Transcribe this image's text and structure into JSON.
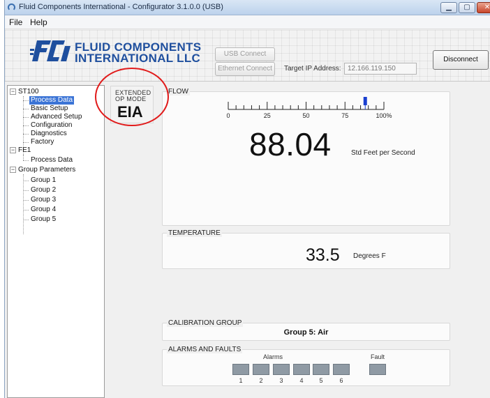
{
  "window": {
    "title": "Fluid Components International - Configurator 3.1.0.0 (USB)"
  },
  "menu": {
    "file": "File",
    "help": "Help"
  },
  "header": {
    "logo_line1": "FLUID COMPONENTS",
    "logo_line2": "INTERNATIONAL LLC",
    "logo_mark": "FCI",
    "usb_connect": "USB Connect",
    "ethernet_connect": "Ethernet Connect",
    "target_ip_label": "Target IP Address:",
    "target_ip_value": "12.166.119.150",
    "disconnect": "Disconnect"
  },
  "tree": {
    "st100": "ST100",
    "st100_children": [
      "Process Data",
      "Basic Setup",
      "Advanced Setup",
      "Configuration",
      "Diagnostics",
      "Factory"
    ],
    "fe1": "FE1",
    "fe1_children": [
      "Process Data"
    ],
    "group_params": "Group Parameters",
    "group_children": [
      "Group 1",
      "Group 2",
      "Group 3",
      "Group 4",
      "Group 5"
    ]
  },
  "op_mode": {
    "label_line1": "EXTENDED",
    "label_line2": "OP MODE",
    "value": "EIA"
  },
  "flow": {
    "title": "FLOW",
    "value": "88.04",
    "unit": "Std Feet per Second",
    "scale_labels": [
      "0",
      "25",
      "50",
      "75",
      "100%"
    ],
    "indicator_percent": 88
  },
  "temperature": {
    "title": "TEMPERATURE",
    "value": "33.5",
    "unit": "Degrees F"
  },
  "calibration": {
    "title": "CALIBRATION GROUP",
    "value": "Group 5: Air"
  },
  "alarms": {
    "title": "ALARMS AND FAULTS",
    "alarms_label": "Alarms",
    "fault_label": "Fault",
    "alarm_numbers": [
      "1",
      "2",
      "3",
      "4",
      "5",
      "6"
    ]
  },
  "colors": {
    "selected": "#3b74d6",
    "annotation": "#e11b1b",
    "brand": "#1f4f9e",
    "indicator": "#1a3fd0"
  }
}
